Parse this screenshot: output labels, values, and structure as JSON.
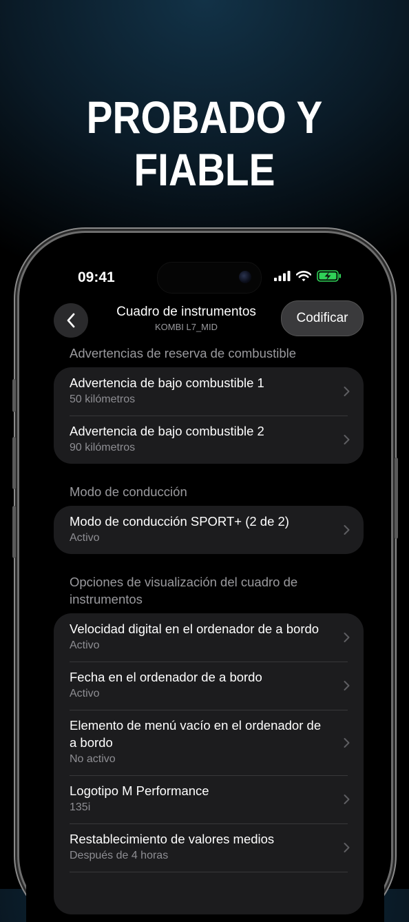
{
  "headline": "PROBADO Y FIABLE",
  "status_bar": {
    "time": "09:41"
  },
  "nav": {
    "title": "Cuadro de instrumentos",
    "subtitle": "KOMBI L7_MID",
    "action_label": "Codificar"
  },
  "sections": [
    {
      "title": "Advertencias de reserva de combustible",
      "rows": [
        {
          "title": "Advertencia de bajo combustible 1",
          "value": "50 kilómetros"
        },
        {
          "title": "Advertencia de bajo combustible 2",
          "value": "90 kilómetros"
        }
      ]
    },
    {
      "title": "Modo de conducción",
      "rows": [
        {
          "title": "Modo de conducción SPORT+ (2 de 2)",
          "value": "Activo"
        }
      ]
    },
    {
      "title": "Opciones de visualización del cuadro de instrumentos",
      "rows": [
        {
          "title": "Velocidad digital en el ordenador de a bordo",
          "value": "Activo"
        },
        {
          "title": "Fecha en el ordenador de a bordo",
          "value": "Activo"
        },
        {
          "title": "Elemento de menú vacío en el ordenador de a bordo",
          "value": "No activo"
        },
        {
          "title": "Logotipo M Performance",
          "value": "135i"
        },
        {
          "title": "Restablecimiento de valores medios",
          "value": "Después de 4 horas"
        }
      ]
    }
  ],
  "icons": {
    "back": "chevron-left-icon",
    "row_chevron": "chevron-right-icon",
    "signal": "cellular-signal-icon",
    "wifi": "wifi-icon",
    "battery": "battery-charging-icon"
  },
  "colors": {
    "battery_green": "#30d158",
    "group_bg": "#1c1c1e",
    "secondary_text": "#8e8e93"
  }
}
